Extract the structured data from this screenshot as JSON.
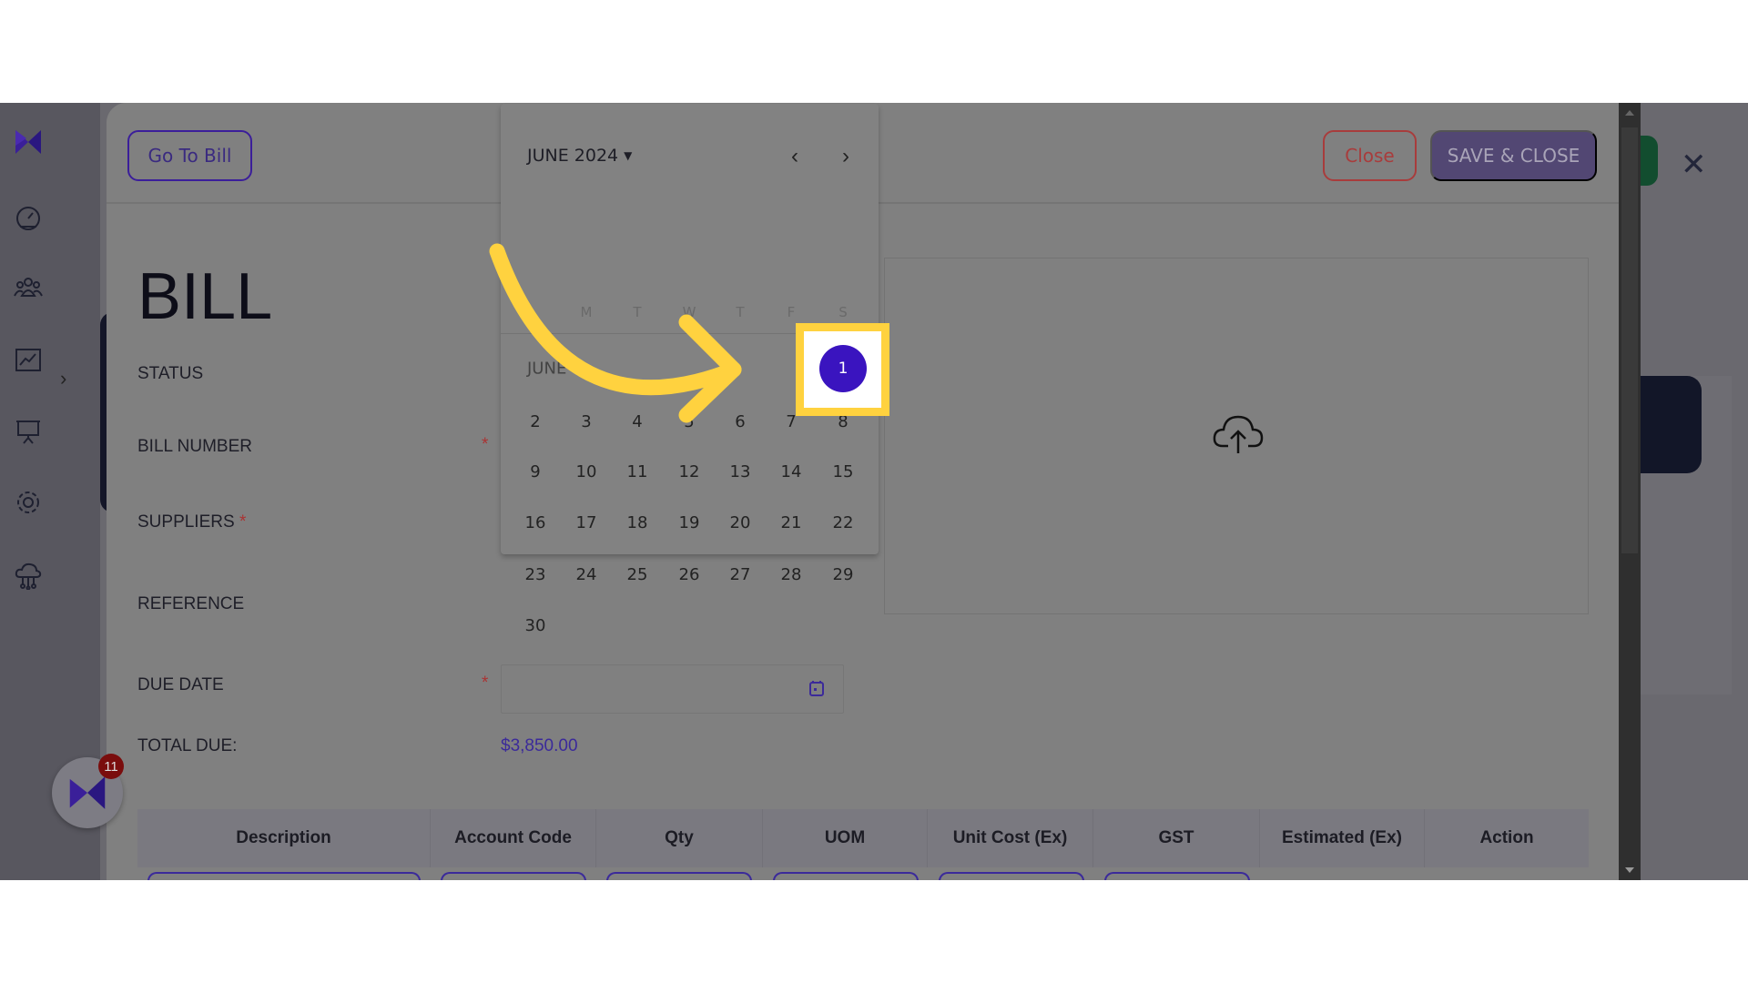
{
  "header": {
    "go_to_bill": "Go To Bill",
    "close": "Close",
    "save_close": "SAVE & CLOSE"
  },
  "form": {
    "title": "BILL",
    "status_label": "STATUS",
    "bill_number_label": "BILL NUMBER",
    "suppliers_label": "SUPPLIERS",
    "reference_label": "REFERENCE",
    "due_date_label": "DUE DATE",
    "due_date_value": "",
    "total_due_label": "TOTAL DUE:",
    "total_due_value": "$3,850.00",
    "required_mark": "*"
  },
  "calendar": {
    "month_label": "JUNE 2024",
    "month_row_label": "JUNE",
    "weekdays": [
      "M",
      "T",
      "W",
      "T",
      "F",
      "S"
    ],
    "selected_day": "1",
    "days": [
      "2",
      "3",
      "4",
      "5",
      "6",
      "7",
      "8",
      "9",
      "10",
      "11",
      "12",
      "13",
      "14",
      "15",
      "16",
      "17",
      "18",
      "19",
      "20",
      "21",
      "22",
      "23",
      "24",
      "25",
      "26",
      "27",
      "28",
      "29",
      "30"
    ]
  },
  "table": {
    "columns": [
      "Description",
      "Account Code",
      "Qty",
      "UOM",
      "Unit Cost (Ex)",
      "GST",
      "Estimated (Ex)",
      "Action"
    ]
  },
  "sidebar": {
    "icons": [
      "dashboard-icon",
      "users-icon",
      "chart-icon",
      "presentation-icon",
      "gear-icon",
      "cloud-icon"
    ]
  },
  "bubble": {
    "badge_count": "11"
  },
  "colors": {
    "accent": "#3a14bf",
    "highlight": "#ffd23f",
    "close": "#a83c3c",
    "total": "#3b2a9a"
  }
}
